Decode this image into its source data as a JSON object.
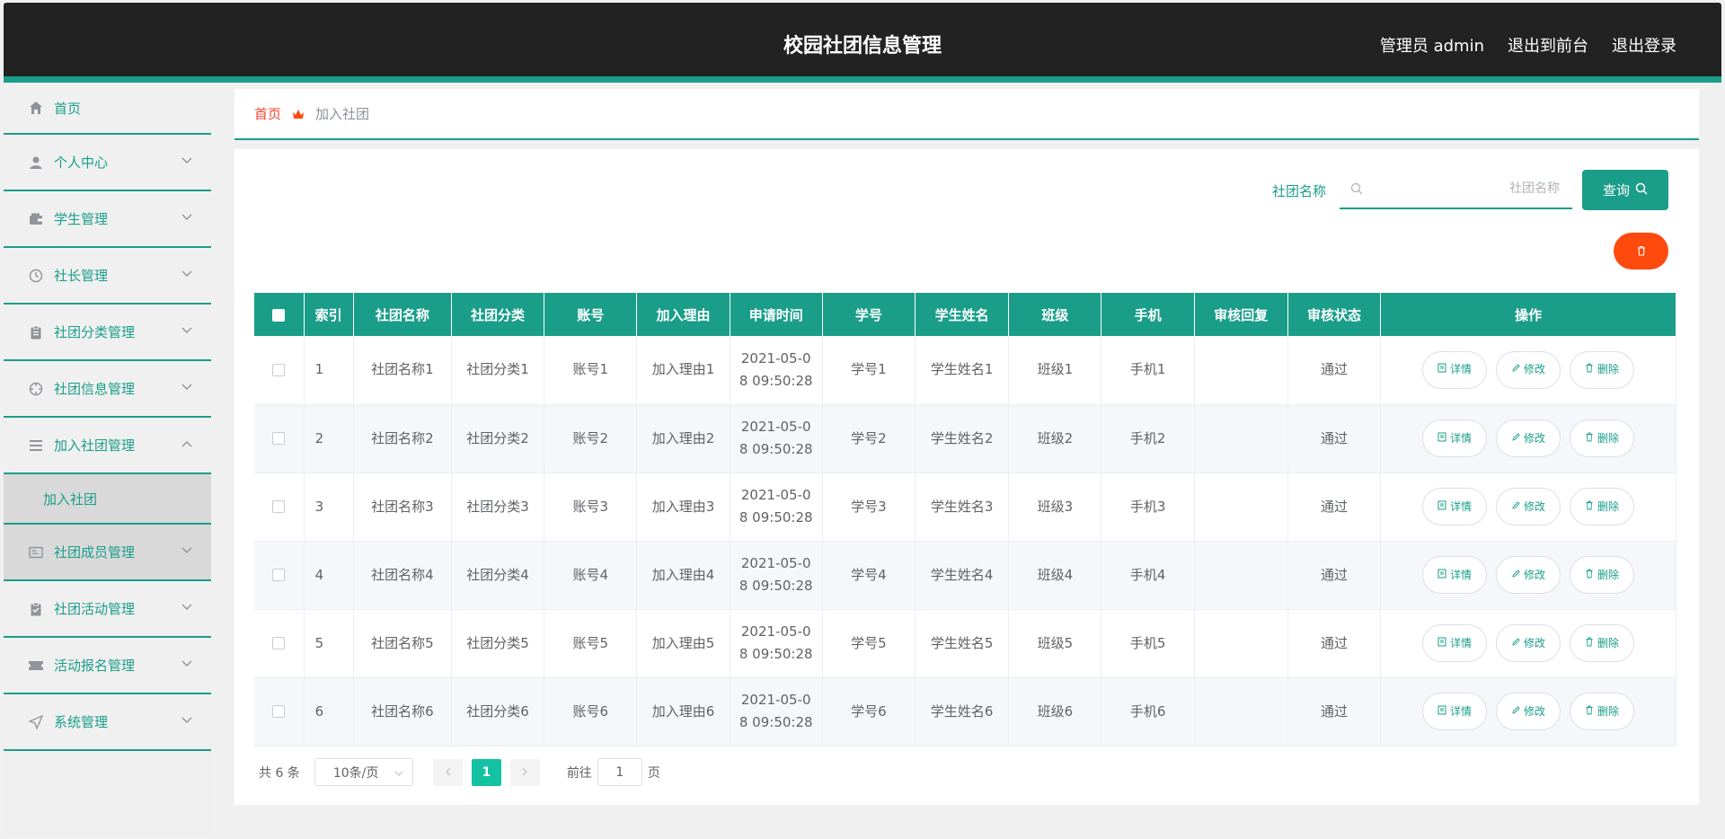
{
  "header": {
    "title": "校园社团信息管理",
    "admin": "管理员 admin",
    "to_front": "退出到前台",
    "logout": "退出登录"
  },
  "sidebar": {
    "items": [
      {
        "label": "首页",
        "icon": "home-icon"
      },
      {
        "label": "个人中心",
        "icon": "user-icon"
      },
      {
        "label": "学生管理",
        "icon": "wallet-icon"
      },
      {
        "label": "社长管理",
        "icon": "clock-icon"
      },
      {
        "label": "社团分类管理",
        "icon": "clipboard-icon"
      },
      {
        "label": "社团信息管理",
        "icon": "target-icon"
      },
      {
        "label": "加入社团管理",
        "icon": "list-icon"
      },
      {
        "label": "社团成员管理",
        "icon": "card-icon"
      },
      {
        "label": "社团活动管理",
        "icon": "checklist-icon"
      },
      {
        "label": "活动报名管理",
        "icon": "ticket-icon"
      },
      {
        "label": "系统管理",
        "icon": "send-icon"
      }
    ],
    "submenu_label": "加入社团"
  },
  "breadcrumb": {
    "home": "首页",
    "current": "加入社团"
  },
  "search": {
    "label": "社团名称",
    "placeholder": "社团名称",
    "button": "查询"
  },
  "table": {
    "headers": [
      "索引",
      "社团名称",
      "社团分类",
      "账号",
      "加入理由",
      "申请时间",
      "学号",
      "学生姓名",
      "班级",
      "手机",
      "审核回复",
      "审核状态",
      "操作"
    ],
    "rows": [
      {
        "index": "1",
        "name": "社团名称1",
        "category": "社团分类1",
        "account": "账号1",
        "reason": "加入理由1",
        "time_a": "2021-05-0",
        "time_b": "8 09:50:28",
        "student_no": "学号1",
        "student_name": "学生姓名1",
        "class": "班级1",
        "phone": "手机1",
        "reply": "",
        "status": "通过"
      },
      {
        "index": "2",
        "name": "社团名称2",
        "category": "社团分类2",
        "account": "账号2",
        "reason": "加入理由2",
        "time_a": "2021-05-0",
        "time_b": "8 09:50:28",
        "student_no": "学号2",
        "student_name": "学生姓名2",
        "class": "班级2",
        "phone": "手机2",
        "reply": "",
        "status": "通过"
      },
      {
        "index": "3",
        "name": "社团名称3",
        "category": "社团分类3",
        "account": "账号3",
        "reason": "加入理由3",
        "time_a": "2021-05-0",
        "time_b": "8 09:50:28",
        "student_no": "学号3",
        "student_name": "学生姓名3",
        "class": "班级3",
        "phone": "手机3",
        "reply": "",
        "status": "通过"
      },
      {
        "index": "4",
        "name": "社团名称4",
        "category": "社团分类4",
        "account": "账号4",
        "reason": "加入理由4",
        "time_a": "2021-05-0",
        "time_b": "8 09:50:28",
        "student_no": "学号4",
        "student_name": "学生姓名4",
        "class": "班级4",
        "phone": "手机4",
        "reply": "",
        "status": "通过"
      },
      {
        "index": "5",
        "name": "社团名称5",
        "category": "社团分类5",
        "account": "账号5",
        "reason": "加入理由5",
        "time_a": "2021-05-0",
        "time_b": "8 09:50:28",
        "student_no": "学号5",
        "student_name": "学生姓名5",
        "class": "班级5",
        "phone": "手机5",
        "reply": "",
        "status": "通过"
      },
      {
        "index": "6",
        "name": "社团名称6",
        "category": "社团分类6",
        "account": "账号6",
        "reason": "加入理由6",
        "time_a": "2021-05-0",
        "time_b": "8 09:50:28",
        "student_no": "学号6",
        "student_name": "学生姓名6",
        "class": "班级6",
        "phone": "手机6",
        "reply": "",
        "status": "通过"
      }
    ],
    "actions": {
      "detail": "详情",
      "edit": "修改",
      "delete": "删除"
    }
  },
  "pagination": {
    "total": "共 6 条",
    "page_size": "10条/页",
    "current_page": "1",
    "goto_prefix": "前往",
    "goto_value": "1",
    "goto_suffix": "页"
  },
  "colors": {
    "accent": "#1a9e8a",
    "header_bg": "#222222",
    "delete_red": "#ff4a0e",
    "breadcrumb_home": "#f4442e",
    "page_active": "#13c2a3"
  }
}
